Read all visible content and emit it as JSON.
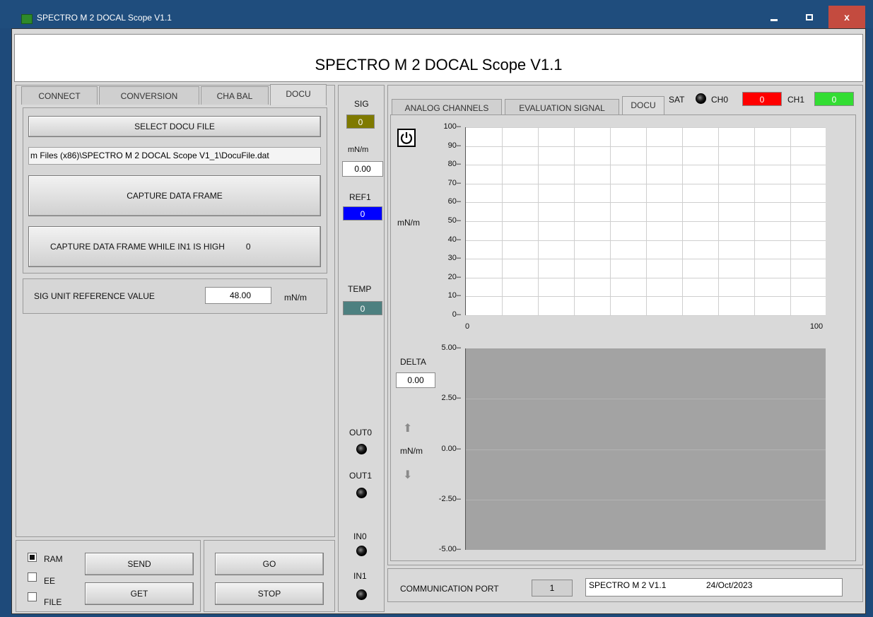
{
  "window": {
    "title": "SPECTRO M 2 DOCAL Scope V1.1",
    "close_glyph": "x"
  },
  "header": {
    "title": "SPECTRO M 2 DOCAL Scope V1.1"
  },
  "left_tabs": [
    {
      "label": "CONNECT"
    },
    {
      "label": "CONVERSION"
    },
    {
      "label": "CHA BAL"
    },
    {
      "label": "DOCU"
    }
  ],
  "docu": {
    "select_button": "SELECT DOCU FILE",
    "file_path": "m Files (x86)\\SPECTRO M 2 DOCAL Scope V1_1\\DocuFile.dat",
    "capture_button": "CAPTURE DATA FRAME",
    "capture_while_button": "CAPTURE DATA FRAME WHILE IN1 IS HIGH",
    "capture_while_count": "0",
    "ref_label": "SIG UNIT REFERENCE VALUE",
    "ref_value": "48.00",
    "ref_unit": "mN/m"
  },
  "storage": {
    "ram_label": "RAM",
    "ee_label": "EE",
    "file_label": "FILE",
    "ram_checked": true,
    "ee_checked": false,
    "file_checked": false,
    "send_button": "SEND",
    "get_button": "GET",
    "go_button": "GO",
    "stop_button": "STOP"
  },
  "mid": {
    "sig_label": "SIG",
    "sig_value": "0",
    "unit_label": "mN/m",
    "unit_value": "0.00",
    "ref1_label": "REF1",
    "ref1_value": "0",
    "temp_label": "TEMP",
    "temp_value": "0",
    "out0_label": "OUT0",
    "out1_label": "OUT1",
    "in0_label": "IN0",
    "in1_label": "IN1"
  },
  "right_tabs": [
    {
      "label": "ANALOG CHANNELS"
    },
    {
      "label": "EVALUATION SIGNAL"
    },
    {
      "label": "DOCU"
    }
  ],
  "status": {
    "sat_label": "SAT",
    "ch0_label": "CH0",
    "ch0_value": "0",
    "ch1_label": "CH1",
    "ch1_value": "0"
  },
  "colors": {
    "sig": "#7f7a00",
    "ref1": "#0000ff",
    "temp": "#4d8080",
    "ch0": "#ff0000",
    "ch1": "#33dd33"
  },
  "chart_top": {
    "ylabel": "mN/m",
    "yticks": [
      "100",
      "90",
      "80",
      "70",
      "60",
      "50",
      "40",
      "30",
      "20",
      "10",
      "0"
    ],
    "xticks": [
      "0",
      "100"
    ],
    "ylim": [
      0,
      100
    ],
    "xlim": [
      0,
      100
    ]
  },
  "chart_bottom": {
    "delta_label": "DELTA",
    "delta_value": "0.00",
    "ylabel": "mN/m",
    "yticks": [
      "5.00",
      "2.50",
      "0.00",
      "-2.50",
      "-5.00"
    ],
    "ylim": [
      -5,
      5
    ]
  },
  "comm": {
    "label": "COMMUNICATION PORT",
    "port": "1",
    "device": "SPECTRO M 2 V1.1",
    "date": "24/Oct/2023"
  }
}
